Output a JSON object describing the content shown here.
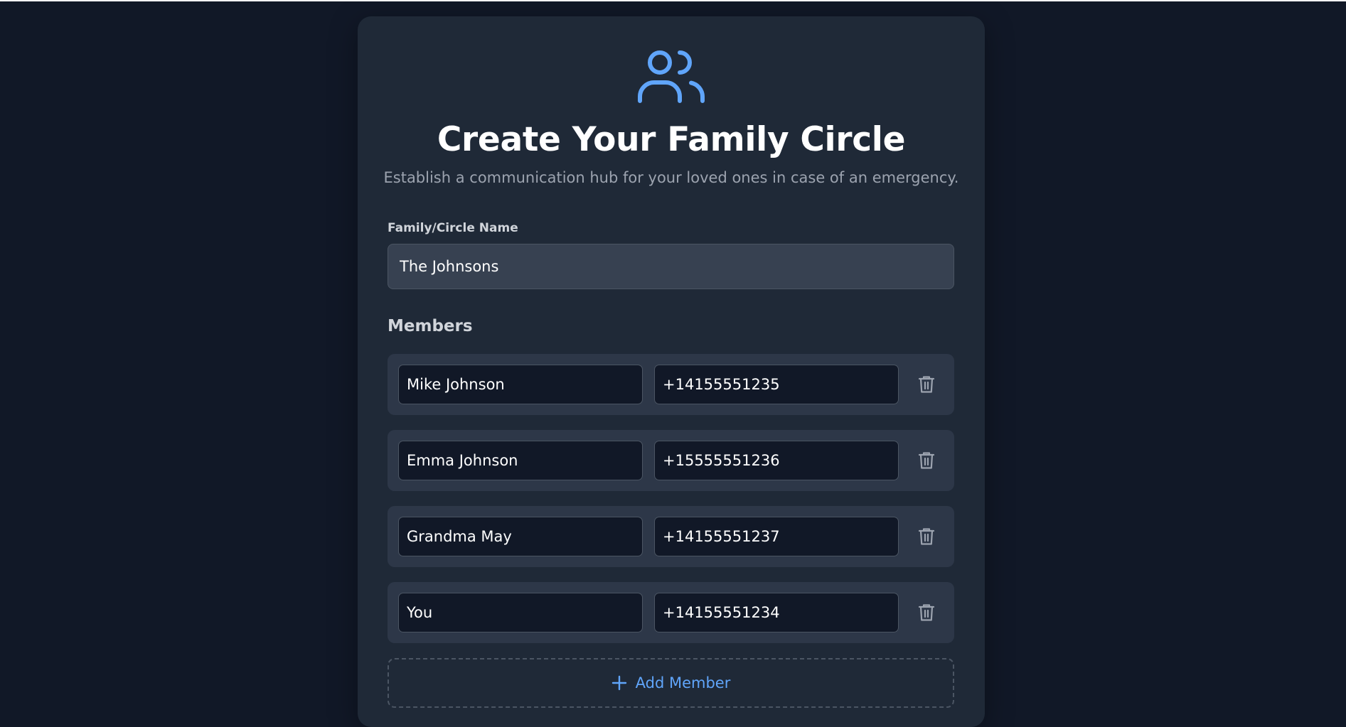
{
  "header": {
    "title": "Create Your Family Circle",
    "subtitle": "Establish a communication hub for your loved ones in case of an emergency.",
    "icon": "users-icon"
  },
  "form": {
    "circle_name_label": "Family/Circle Name",
    "circle_name_value": "The Johnsons",
    "members_title": "Members",
    "members": [
      {
        "name": "Mike Johnson",
        "phone": "+14155551235"
      },
      {
        "name": "Emma Johnson",
        "phone": "+15555551236"
      },
      {
        "name": "Grandma May",
        "phone": "+14155551237"
      },
      {
        "name": "You",
        "phone": "+14155551234"
      }
    ],
    "add_member_label": "Add Member"
  },
  "colors": {
    "background": "#111827",
    "card": "#1f2937",
    "accent": "#60a5fa",
    "row": "#2d3748"
  }
}
